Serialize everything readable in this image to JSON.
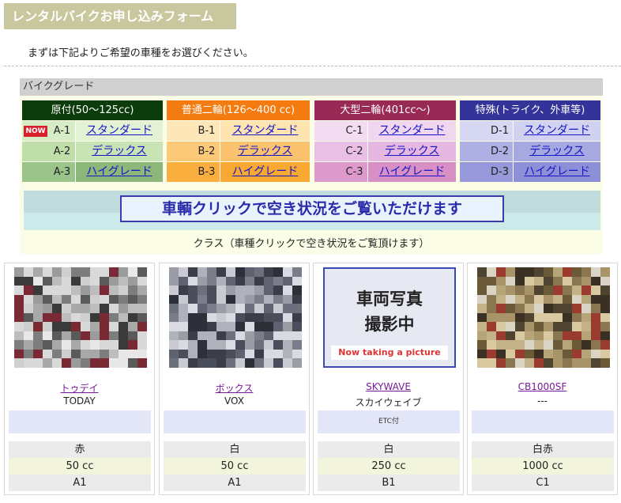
{
  "page_title": "レンタルバイクお申し込みフォーム",
  "intro": "まずは下記よりご希望の車種をお選びください。",
  "grade_header": "バイクグレード",
  "grades": [
    {
      "title": "原付(50〜125cc)",
      "header_color": "#0c3c0c",
      "rows": [
        {
          "badge": "NOW",
          "code": "A-1",
          "label": "スタンダード",
          "bg": "#e3f2d3",
          "code_bg": "#d6ecc6"
        },
        {
          "badge": "",
          "code": "A-2",
          "label": "デラックス",
          "bg": "#c8e3b4",
          "code_bg": "#c0deaa"
        },
        {
          "badge": "",
          "code": "A-3",
          "label": "ハイグレード",
          "bg": "#8bb77a",
          "code_bg": "#9ac48a"
        }
      ]
    },
    {
      "title": "普通二輪(126〜400 cc)",
      "header_color": "#f47b0f",
      "rows": [
        {
          "badge": "",
          "code": "B-1",
          "label": "スタンダード",
          "bg": "#fde4b0",
          "code_bg": "#fde7b8"
        },
        {
          "badge": "",
          "code": "B-2",
          "label": "デラックス",
          "bg": "#fbc36e",
          "code_bg": "#fcc978"
        },
        {
          "badge": "",
          "code": "B-3",
          "label": "ハイグレード",
          "bg": "#f9a932",
          "code_bg": "#f9ae3e"
        }
      ]
    },
    {
      "title": "大型二輪(401cc〜)",
      "header_color": "#992a55",
      "rows": [
        {
          "badge": "",
          "code": "C-1",
          "label": "スタンダード",
          "bg": "#f0d6ee",
          "code_bg": "#f3dcf1"
        },
        {
          "badge": "",
          "code": "C-2",
          "label": "デラックス",
          "bg": "#e6b7e0",
          "code_bg": "#eabfe5"
        },
        {
          "badge": "",
          "code": "C-3",
          "label": "ハイグレード",
          "bg": "#d78fc4",
          "code_bg": "#dc99ca"
        }
      ]
    },
    {
      "title": "特殊(トライク、外車等)",
      "header_color": "#33339a",
      "rows": [
        {
          "badge": "",
          "code": "D-1",
          "label": "スタンダード",
          "bg": "#d0d2f0",
          "code_bg": "#d6d7f3"
        },
        {
          "badge": "",
          "code": "D-2",
          "label": "デラックス",
          "bg": "#a6a8e0",
          "code_bg": "#aeb0e4"
        },
        {
          "badge": "",
          "code": "D-3",
          "label": "ハイグレード",
          "bg": "#8e90d7",
          "code_bg": "#9698da"
        }
      ]
    }
  ],
  "banner_text": "車輌クリックで空き状況をご覧いただけます",
  "class_note": "クラス（車種クリックで空き状況をご覧頂けます）",
  "placeholder_photo": {
    "line1": "車両写真",
    "line2": "撮影中",
    "sub": "Now taking a picture"
  },
  "vehicles": [
    {
      "name": "トゥデイ",
      "sub": "TODAY",
      "feature": "",
      "color": "赤",
      "cc": "50 cc",
      "cls": "A1",
      "photo": "pixel",
      "palette": [
        "#d9d9d9",
        "#cfcfcf",
        "#bdbdbd",
        "#a8a8a8",
        "#7d7d7d",
        "#5a5a5a",
        "#3a3a3a",
        "#7a2a35",
        "#9b9b9b",
        "#e8e8e8"
      ]
    },
    {
      "name": "ボックス",
      "sub": "VOX",
      "feature": "",
      "color": "白",
      "cc": "50 cc",
      "cls": "A1",
      "photo": "pixel",
      "palette": [
        "#5f6270",
        "#4a4d5a",
        "#7b7e8a",
        "#9a9ca6",
        "#3b3d48",
        "#c9cad2",
        "#dadbe2",
        "#2e3039",
        "#6c6f7c",
        "#b0b2bb"
      ]
    },
    {
      "name": "SKYWAVE",
      "sub": "スカイウェイブ",
      "feature": "ETC付",
      "color": "白",
      "cc": "250 cc",
      "cls": "B1",
      "photo": "placeholder",
      "palette": []
    },
    {
      "name": "CB1000SF",
      "sub": "---",
      "feature": "",
      "color": "白赤",
      "cc": "1000 cc",
      "cls": "C1",
      "photo": "pixel",
      "palette": [
        "#8a7650",
        "#6b5a38",
        "#a89468",
        "#c3b288",
        "#4f4430",
        "#d8c9a0",
        "#3a3124",
        "#9a3b30",
        "#b7a57a",
        "#d9d4c4"
      ]
    }
  ]
}
